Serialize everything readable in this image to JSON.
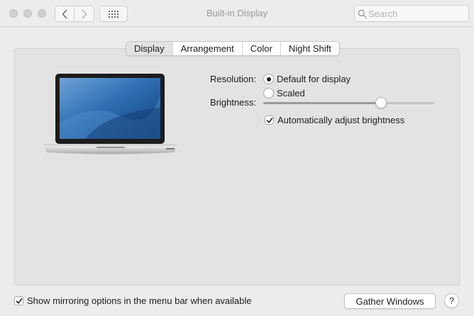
{
  "window": {
    "title": "Built-in Display"
  },
  "toolbar": {
    "search_placeholder": "Search"
  },
  "tabs": [
    {
      "label": "Display",
      "active": true
    },
    {
      "label": "Arrangement",
      "active": false
    },
    {
      "label": "Color",
      "active": false
    },
    {
      "label": "Night Shift",
      "active": false
    }
  ],
  "display": {
    "resolution_label": "Resolution:",
    "resolution_options": [
      {
        "label": "Default for display",
        "selected": true
      },
      {
        "label": "Scaled",
        "selected": false
      }
    ],
    "brightness_label": "Brightness:",
    "brightness_level": 0.7,
    "auto_brightness_label": "Automatically adjust brightness",
    "auto_brightness_checked": true
  },
  "footer": {
    "mirroring_label": "Show mirroring options in the menu bar when available",
    "mirroring_checked": true,
    "gather_windows_label": "Gather Windows",
    "help_label": "?"
  }
}
